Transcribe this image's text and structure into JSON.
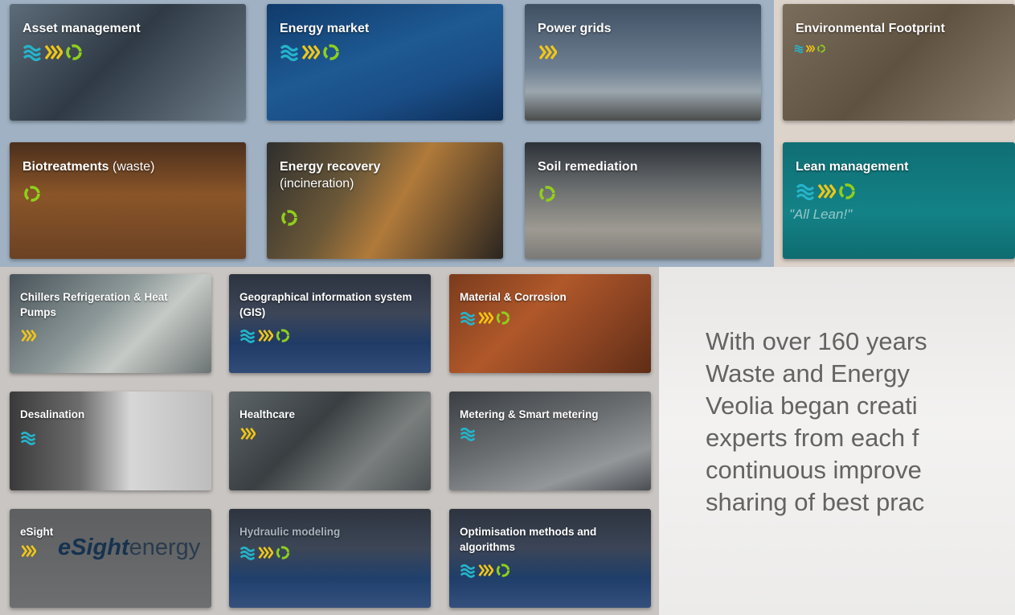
{
  "tiles": [
    {
      "title": "Asset management",
      "icons": [
        "water",
        "waste",
        "energy"
      ],
      "bg": "linear-gradient(135deg,#5d6c79 0%,#2f3a45 45%,#4b5864 70%,#6d7c88 100%)"
    },
    {
      "title": "Energy market",
      "icons": [
        "water",
        "waste",
        "energy"
      ],
      "bg": "linear-gradient(160deg,#103a6b 0%,#1e5a93 45%,#1a4d86 70%,#0d2e57 100%)"
    },
    {
      "title": "Power grids",
      "icons": [
        "waste"
      ],
      "bg": "linear-gradient(180deg,#3f5063 0%,#6e7f92 55%,#9ba6ae 75%,#4a4c4b 100%)"
    },
    {
      "title": "Environmental Footprint",
      "icons": [
        "water",
        "waste",
        "energy"
      ],
      "bg": "linear-gradient(135deg,#7a6d5b 0%,#5f5240 50%,#8a7d6b 100%)"
    },
    {
      "title": "Biotreatments",
      "sub": " (waste)",
      "icons": [
        "energy"
      ],
      "bg": "linear-gradient(180deg,#4b2f1d 0%,#8a5528 45%,#6b4224 100%)"
    },
    {
      "title": "Energy recovery",
      "line2": "(incineration)",
      "icons": [
        "energy"
      ],
      "bg": "linear-gradient(120deg,#2f2f2e 0%,#6b5838 35%,#b07a3a 55%,#2a2520 100%)"
    },
    {
      "title": "Soil remediation",
      "icons": [
        "energy"
      ],
      "bg": "linear-gradient(180deg,#2c3138 0%,#6c6f70 40%,#9e9a92 75%,#7b7a77 100%)"
    },
    {
      "title": "Lean management",
      "tag": "\"All Lean!\"",
      "icons": [
        "water",
        "waste",
        "energy"
      ],
      "bg": "linear-gradient(180deg,#0f6f74 0%,#138287 60%,#0e6c70 100%)"
    },
    {
      "title": "Chillers Refrigeration & Heat Pumps",
      "icons": [
        "waste"
      ],
      "bg": "linear-gradient(135deg,#49535a 0%,#8e9a9a 45%,#c6cac6 65%,#6c7474 100%)"
    },
    {
      "title": "Geographical information system (GIS)",
      "icons": [
        "water",
        "waste",
        "energy"
      ],
      "bg": "linear-gradient(180deg,#2d3440 0%,#3d4658 40%,#1f3b66 70%,#324c78 100%)"
    },
    {
      "title": "Material & Corrosion",
      "icons": [
        "water",
        "waste",
        "energy"
      ],
      "bg": "linear-gradient(135deg,#7a3b1d 0%,#b0582a 40%,#8a4322 70%,#5e2d16 100%)"
    },
    {
      "title": "Desalination",
      "icons": [
        "water"
      ],
      "bg": "linear-gradient(90deg,#3a3a3a 0%,#6d6d6d 35%,#d7d7d7 60%,#bdbdbd 100%)"
    },
    {
      "title": "Healthcare",
      "icons": [
        "waste"
      ],
      "bg": "linear-gradient(135deg,#5d6568 0%,#3a3f42 40%,#7a7f7e 70%,#4a4f52 100%)"
    },
    {
      "title": "Metering & Smart metering",
      "icons": [
        "water"
      ],
      "bg": "linear-gradient(160deg,#3b3f44 0%,#6b6e70 45%,#94979a 75%,#4a4d51 100%)"
    },
    {
      "title": "eSight",
      "icons": [
        "waste"
      ],
      "logo": true,
      "bg": "linear-gradient(180deg,#5d5f61 0%,#6c6e70 100%)"
    },
    {
      "title": "Hydraulic modeling",
      "dim": true,
      "icons": [
        "water",
        "waste",
        "energy"
      ],
      "bg": "linear-gradient(180deg,#2e3540 0%,#3c4656 40%,#20406c 70%,#35507d 100%)"
    },
    {
      "title": "Optimisation methods and algorithms",
      "icons": [
        "water",
        "waste",
        "energy"
      ],
      "bg": "linear-gradient(180deg,#2d343f 0%,#3b4557 40%,#1f3e69 70%,#344f7b 100%)"
    }
  ],
  "logo": {
    "bold": "eSight",
    "rest": "energy"
  },
  "intro_lines": [
    "With over 160 years",
    "Waste and Energy",
    "Veolia began creati",
    "experts from each f",
    "continuous improve",
    "sharing of best prac"
  ],
  "colors": {
    "water": "#25b3c9",
    "waste": "#f2c614",
    "energy": "#8fcf1b"
  }
}
